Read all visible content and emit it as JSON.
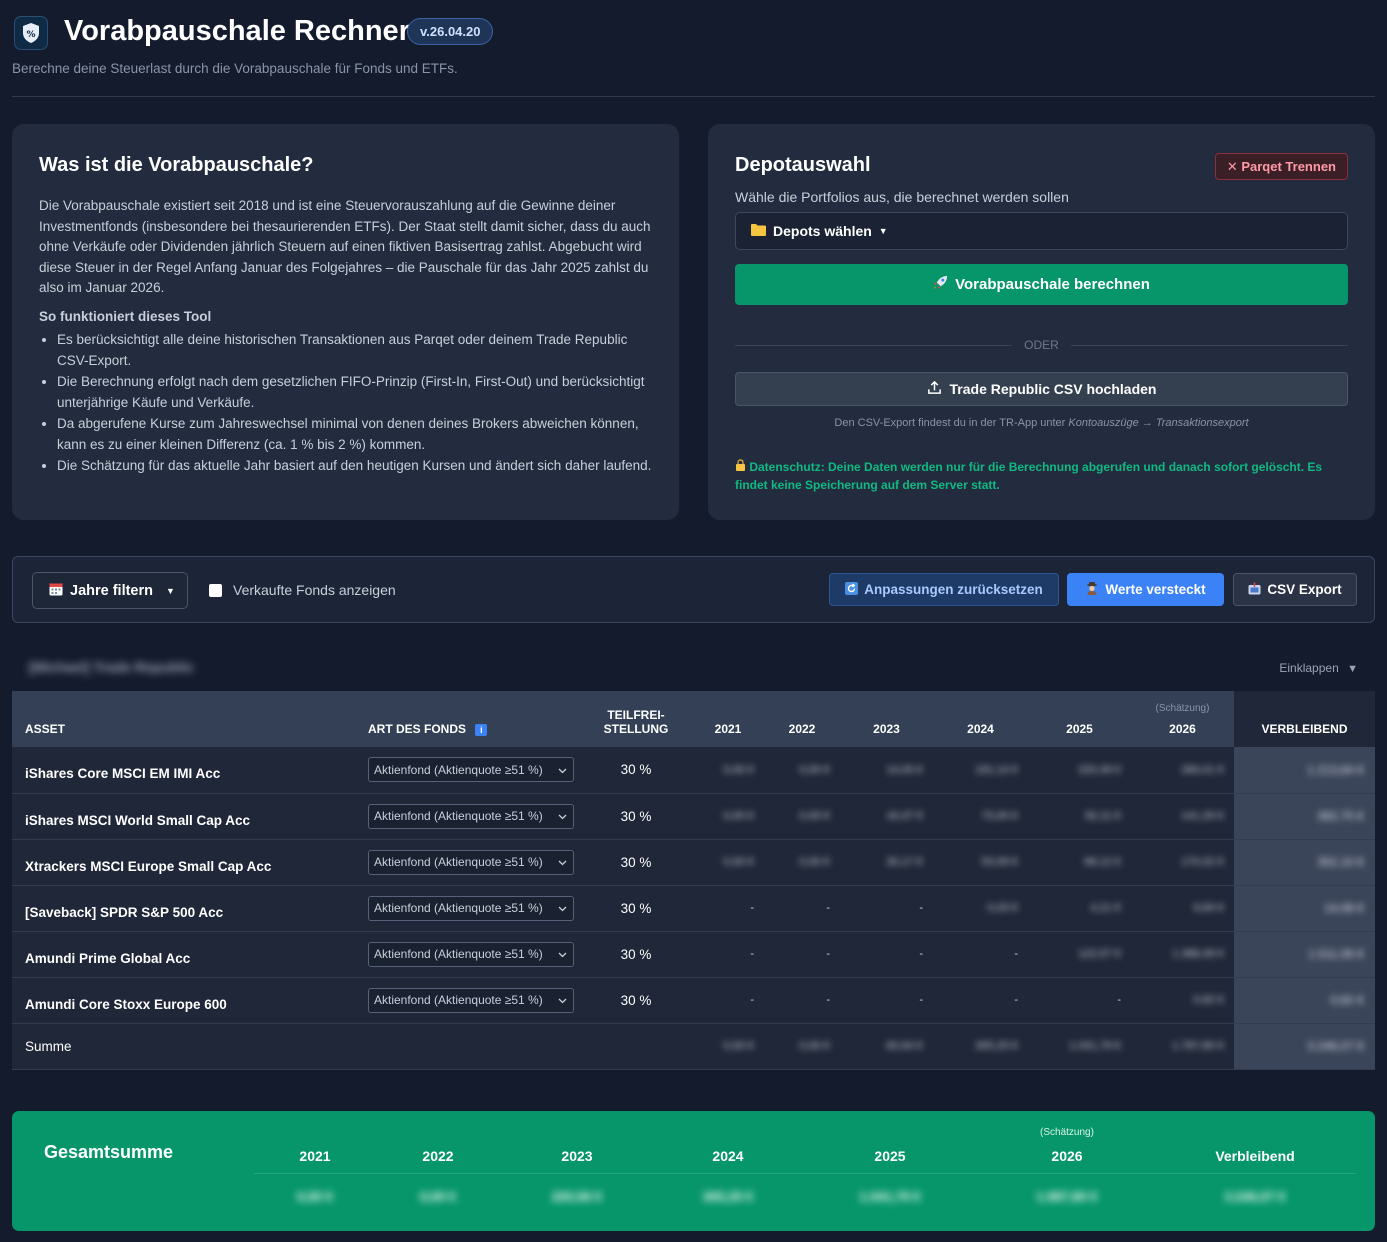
{
  "app": {
    "title": "Vorabpauschale Rechner",
    "version": "v.26.04.20",
    "subtitle": "Berechne deine Steuerlast durch die Vorabpauschale für Fonds und ETFs."
  },
  "info": {
    "title": "Was ist die Vorabpauschale?",
    "text": "Die Vorabpauschale existiert seit 2018 und ist eine Steuervorauszahlung auf die Gewinne deiner Investmentfonds (insbesondere bei thesaurierenden ETFs). Der Staat stellt damit sicher, dass du auch ohne Verkäufe oder Dividenden jährlich Steuern auf einen fiktiven Basisertrag zahlst. Abgebucht wird diese Steuer in der Regel Anfang Januar des Folgejahres – die Pauschale für das Jahr 2025 zahlst du also im Januar 2026.",
    "how_title": "So funktioniert dieses Tool",
    "bullets": [
      "Es berücksichtigt alle deine historischen Transaktionen aus Parqet oder deinem Trade Republic CSV-Export.",
      "Die Berechnung erfolgt nach dem gesetzlichen FIFO-Prinzip (First-In, First-Out) und berücksichtigt unterjährige Käufe und Verkäufe.",
      "Da abgerufene Kurse zum Jahreswechsel minimal von denen deines Brokers abweichen können, kann es zu einer kleinen Differenz (ca. 1 % bis 2 %) kommen.",
      "Die Schätzung für das aktuelle Jahr basiert auf den heutigen Kursen und ändert sich daher laufend."
    ]
  },
  "depot": {
    "title": "Depotauswahl",
    "disconnect_label": "✕ Parqet Trennen",
    "hint": "Wähle die Portfolios aus, die berechnet werden sollen",
    "select_label": "Depots wählen",
    "calc_label": "Vorabpauschale berechnen",
    "oder": "ODER",
    "upload_label": "Trade Republic CSV hochladen",
    "csv_hint_prefix": "Den CSV-Export findest du in der TR-App unter ",
    "csv_hint_path": "Kontoauszüge → Transaktionsexport",
    "privacy": "Datenschutz: Deine Daten werden nur für die Berechnung abgerufen und danach sofort gelöscht. Es findet keine Speicherung auf dem Server statt."
  },
  "toolbar": {
    "years_label": "Jahre filtern",
    "sold_label": "Verkaufte Fonds anzeigen",
    "reset_label": "Anpassungen zurücksetzen",
    "hide_label": "Werte versteckt",
    "csv_label": "CSV Export"
  },
  "portfolio": {
    "name": "[Michael] Trade Republic",
    "collapse_label": "Einklappen"
  },
  "table": {
    "headers": {
      "asset": "ASSET",
      "art": "ART DES FONDS",
      "tf_line1": "TEILFREI-",
      "tf_line2": "STELLUNG",
      "y2021": "2021",
      "y2022": "2022",
      "y2023": "2023",
      "y2024": "2024",
      "y2025": "2025",
      "y2026": "2026",
      "estimate": "(Schätzung)",
      "remaining": "VERBLEIBEND"
    },
    "fund_type": "Aktienfond (Aktienquote ≥51 %)",
    "rows": [
      {
        "asset": "iShares Core MSCI EM IMI Acc",
        "tf": "30 %",
        "v": [
          "0,00 €",
          "0,00 €",
          "14,00 €",
          "191,14 €",
          "220,49 €",
          "284,01 €"
        ],
        "rem": "1.213,84 €"
      },
      {
        "asset": "iShares MSCI World Small Cap Acc",
        "tf": "30 %",
        "v": [
          "0,00 €",
          "0,00 €",
          "16,47 €",
          "73,00 €",
          "92,11 €",
          "141,33 €"
        ],
        "rem": "382,70 €"
      },
      {
        "asset": "Xtrackers MSCI Europe Small Cap Acc",
        "tf": "30 %",
        "v": [
          "0,00 €",
          "0,00 €",
          "30,17 €",
          "53,09 €",
          "68,12 €",
          "170,02 €"
        ],
        "rem": "352,10 €"
      },
      {
        "asset": "[Saveback] SPDR S&P 500 Acc",
        "tf": "30 %",
        "v": [
          "-",
          "-",
          "-",
          "0,03 €",
          "4,21 €",
          "9,84 €"
        ],
        "rem": "14,08 €"
      },
      {
        "asset": "Amundi Prime Global Acc",
        "tf": "30 %",
        "v": [
          "-",
          "-",
          "-",
          "-",
          "122,57 €",
          "1.388,49 €"
        ],
        "rem": "1.511,06 €"
      },
      {
        "asset": "Amundi Core Stoxx Europe 600",
        "tf": "30 %",
        "v": [
          "-",
          "-",
          "-",
          "-",
          "-",
          "0,82 €"
        ],
        "rem": "0,82 €"
      }
    ],
    "sum": {
      "label": "Summe",
      "v": [
        "0,00 €",
        "0,00 €",
        "60,64 €",
        "305,25 €",
        "1.041,79 €",
        "1.787,80 €"
      ],
      "rem": "3.246,07 €"
    }
  },
  "total": {
    "title": "Gesamtsumme",
    "estimate": "(Schätzung)",
    "cols": [
      {
        "year": "2021",
        "value": "0,00 €"
      },
      {
        "year": "2022",
        "value": "0,00 €"
      },
      {
        "year": "2023",
        "value": "220,56 €"
      },
      {
        "year": "2024",
        "value": "305,25 €"
      },
      {
        "year": "2025",
        "value": "1.041,79 €"
      },
      {
        "year": "2026",
        "value": "1.987,80 €"
      },
      {
        "year": "Verbleibend",
        "value": "3.246,07 €"
      }
    ]
  }
}
